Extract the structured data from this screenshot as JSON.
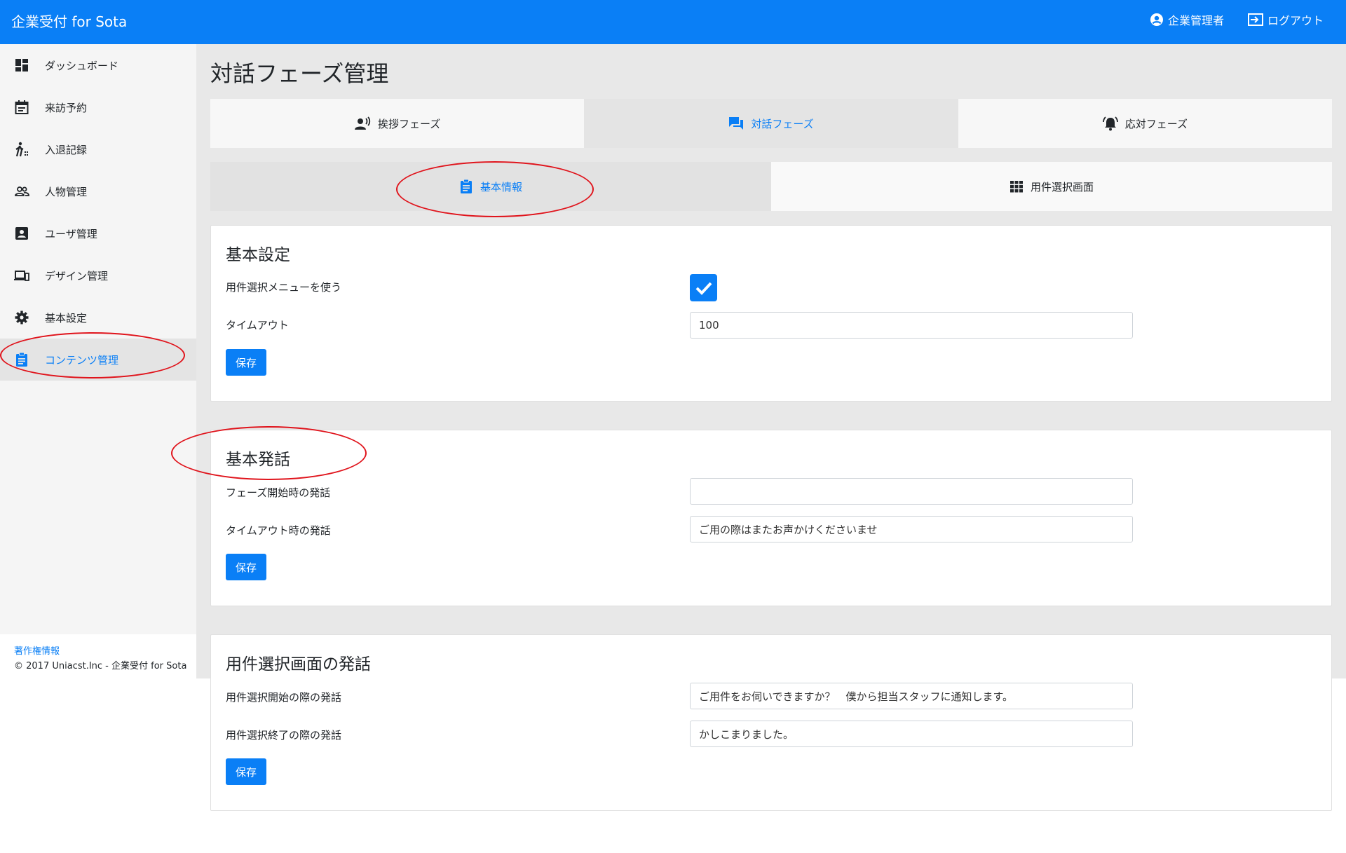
{
  "app": {
    "title": "企業受付 for Sota"
  },
  "header": {
    "user_label": "企業管理者",
    "logout_label": "ログアウト"
  },
  "sidebar": {
    "items": [
      {
        "label": "ダッシュボード",
        "icon": "dashboard-icon"
      },
      {
        "label": "来訪予約",
        "icon": "calendar-icon"
      },
      {
        "label": "入退記録",
        "icon": "walk-icon"
      },
      {
        "label": "人物管理",
        "icon": "people-icon"
      },
      {
        "label": "ユーザ管理",
        "icon": "account-box-icon"
      },
      {
        "label": "デザイン管理",
        "icon": "devices-icon"
      },
      {
        "label": "基本設定",
        "icon": "gear-icon"
      },
      {
        "label": "コンテンツ管理",
        "icon": "clipboard-icon",
        "active": true
      }
    ]
  },
  "footer": {
    "link_label": "著作権情報",
    "copyright": "© 2017 Uniacst.Inc - 企業受付 for Sota"
  },
  "page": {
    "title": "対話フェーズ管理"
  },
  "phase_tabs": [
    {
      "label": "挨拶フェーズ",
      "icon": "speaking-person-icon"
    },
    {
      "label": "対話フェーズ",
      "icon": "chat-icon",
      "active": true
    },
    {
      "label": "応対フェーズ",
      "icon": "bell-icon"
    }
  ],
  "sub_tabs": [
    {
      "label": "基本情報",
      "icon": "clipboard-icon",
      "active": true
    },
    {
      "label": "用件選択画面",
      "icon": "grid-icon"
    }
  ],
  "basic_settings": {
    "title": "基本設定",
    "use_menu_label": "用件選択メニューを使う",
    "use_menu_checked": true,
    "timeout_label": "タイムアウト",
    "timeout_value": "100",
    "save_label": "保存"
  },
  "basic_speech": {
    "title": "基本発話",
    "phase_start_label": "フェーズ開始時の発話",
    "phase_start_value": "",
    "timeout_speech_label": "タイムアウト時の発話",
    "timeout_speech_value": "ご用の際はまたお声かけくださいませ",
    "save_label": "保存"
  },
  "selection_speech": {
    "title": "用件選択画面の発話",
    "start_label": "用件選択開始の際の発話",
    "start_value": "ご用件をお伺いできますか？　僕から担当スタッフに通知します。",
    "end_label": "用件選択終了の際の発話",
    "end_value": "かしこまりました。",
    "save_label": "保存"
  },
  "colors": {
    "primary": "#0a7ff6",
    "annotation": "#e0141c"
  }
}
